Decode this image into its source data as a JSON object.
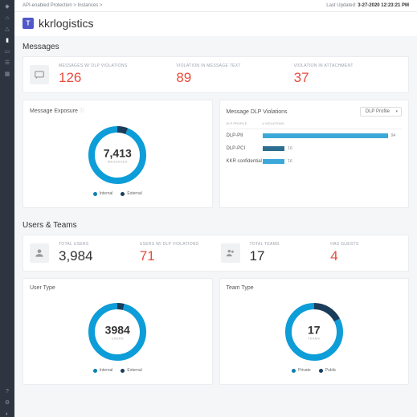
{
  "breadcrumb": "API-enabled Protection > Instances >",
  "last_updated_label": "Last Updated:",
  "last_updated_value": "3-27-2020 12:23:21 PM",
  "page_title": "kkrlogistics",
  "messages": {
    "section_title": "Messages",
    "stats": [
      {
        "label": "MESSAGES W/ DLP VIOLATIONS",
        "value": "126"
      },
      {
        "label": "VIOLATION IN MESSAGE TEXT",
        "value": "89"
      },
      {
        "label": "VIOLATION IN ATTACHMENT",
        "value": "37"
      }
    ],
    "exposure": {
      "title": "Message Exposure",
      "center_value": "7,413",
      "center_label": "MESSAGES",
      "legend": [
        {
          "label": "Internal",
          "color": "#0d7fb0"
        },
        {
          "label": "External",
          "color": "#1a3d5c"
        }
      ]
    },
    "violations": {
      "title": "Message DLP Violations",
      "dropdown": "DLP Profile",
      "col1": "DLP PROFILE",
      "col2": "# VIOLATIONS",
      "rows": [
        {
          "name": "DLP-PII",
          "value": "94",
          "width": 90
        },
        {
          "name": "DLP-PCI",
          "value": "16",
          "width": 16
        },
        {
          "name": "KKR confidential",
          "value": "16",
          "width": 16
        }
      ]
    }
  },
  "users": {
    "section_title": "Users & Teams",
    "stats": [
      {
        "label": "TOTAL USERS",
        "value": "3,984",
        "red": false
      },
      {
        "label": "USERS W/ DLP VIOLATIONS",
        "value": "71",
        "red": true
      },
      {
        "label": "TOTAL TEAMS",
        "value": "17",
        "red": false
      },
      {
        "label": "HAS GUESTS",
        "value": "4",
        "red": true
      }
    ],
    "user_type": {
      "title": "User Type",
      "center_value": "3984",
      "center_label": "USERS",
      "legend": [
        {
          "label": "Internal",
          "color": "#0d7fb0"
        },
        {
          "label": "External",
          "color": "#1a3d5c"
        }
      ]
    },
    "team_type": {
      "title": "Team Type",
      "center_value": "17",
      "center_label": "TEAMS",
      "legend": [
        {
          "label": "Private",
          "color": "#0d7fb0"
        },
        {
          "label": "Public",
          "color": "#1a3d5c"
        }
      ]
    }
  },
  "chart_data": [
    {
      "type": "pie",
      "title": "Message Exposure",
      "series": [
        {
          "name": "Internal",
          "value": 7000
        },
        {
          "name": "External",
          "value": 413
        }
      ],
      "total": 7413
    },
    {
      "type": "bar",
      "title": "Message DLP Violations",
      "categories": [
        "DLP-PII",
        "DLP-PCI",
        "KKR confidential"
      ],
      "values": [
        94,
        16,
        16
      ]
    },
    {
      "type": "pie",
      "title": "User Type",
      "series": [
        {
          "name": "Internal",
          "value": 3900
        },
        {
          "name": "External",
          "value": 84
        }
      ],
      "total": 3984
    },
    {
      "type": "pie",
      "title": "Team Type",
      "series": [
        {
          "name": "Private",
          "value": 14
        },
        {
          "name": "Public",
          "value": 3
        }
      ],
      "total": 17
    }
  ]
}
